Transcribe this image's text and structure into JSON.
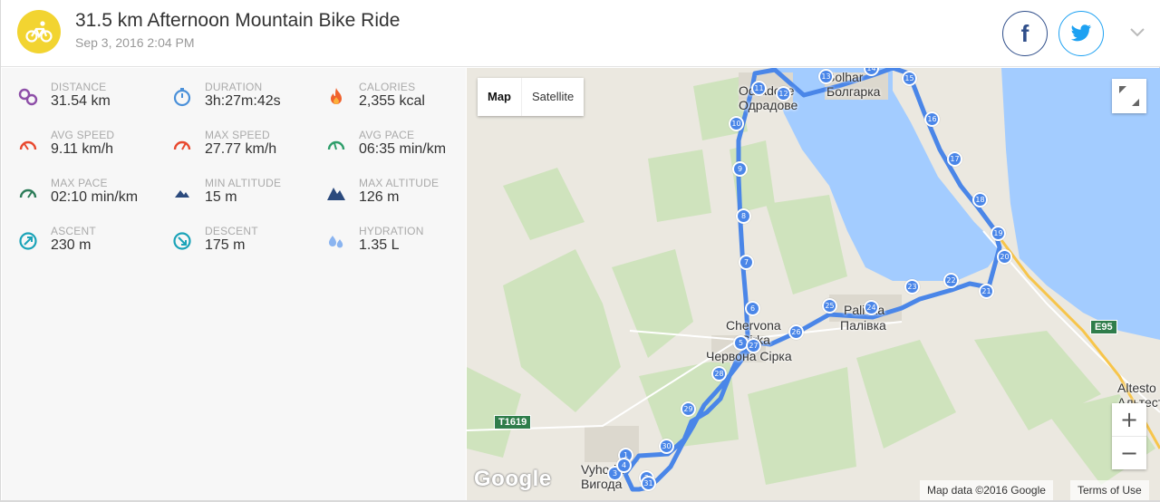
{
  "activity": {
    "title": "31.5 km Afternoon Mountain Bike Ride",
    "datetime": "Sep 3, 2016 2:04 PM",
    "sport_icon": "mountain-bike-icon",
    "badge_color": "#f2d431"
  },
  "share": {
    "facebook_label": "f",
    "facebook_icon": "facebook-icon",
    "twitter_icon": "twitter-icon",
    "menu_icon": "chevron-down-icon"
  },
  "stats": [
    {
      "key": "distance",
      "label": "DISTANCE",
      "value": "31.54 km",
      "icon": "distance-icon",
      "color": "#8e4fa8"
    },
    {
      "key": "duration",
      "label": "DURATION",
      "value": "3h:27m:42s",
      "icon": "stopwatch-icon",
      "color": "#4a90d9"
    },
    {
      "key": "calories",
      "label": "CALORIES",
      "value": "2,355 kcal",
      "icon": "flame-icon",
      "color": "#f0622d"
    },
    {
      "key": "avg_speed",
      "label": "AVG SPEED",
      "value": "9.11 km/h",
      "icon": "speedometer-icon",
      "color": "#e8492f"
    },
    {
      "key": "max_speed",
      "label": "MAX SPEED",
      "value": "27.77 km/h",
      "icon": "speedometer-icon",
      "color": "#e8492f"
    },
    {
      "key": "avg_pace",
      "label": "AVG PACE",
      "value": "06:35 min/km",
      "icon": "pace-gauge-icon",
      "color": "#2e9e6a"
    },
    {
      "key": "max_pace",
      "label": "MAX PACE",
      "value": "02:10 min/km",
      "icon": "pace-gauge-icon",
      "color": "#2e7d5a"
    },
    {
      "key": "min_altitude",
      "label": "MIN ALTITUDE",
      "value": "15 m",
      "icon": "mountain-small-icon",
      "color": "#2b4a7d"
    },
    {
      "key": "max_altitude",
      "label": "MAX ALTITUDE",
      "value": "126 m",
      "icon": "mountain-large-icon",
      "color": "#2b4a7d"
    },
    {
      "key": "ascent",
      "label": "ASCENT",
      "value": "230 m",
      "icon": "ascent-arrow-icon",
      "color": "#1aa3b8"
    },
    {
      "key": "descent",
      "label": "DESCENT",
      "value": "175 m",
      "icon": "descent-arrow-icon",
      "color": "#1aa3b8"
    },
    {
      "key": "hydration",
      "label": "HYDRATION",
      "value": "1.35 L",
      "icon": "water-drops-icon",
      "color": "#8ab4f0"
    }
  ],
  "map": {
    "type_buttons": {
      "map": "Map",
      "satellite": "Satellite"
    },
    "zoom_in": "+",
    "zoom_out": "−",
    "logo": "Google",
    "attribution": "Map data ©2016 Google",
    "terms": "Terms of Use",
    "labels": {
      "odradove": "Odradove",
      "odradove_cyr": "Одрадове",
      "bolhar": "Bolhar",
      "bolhar_cyr": "Болгарка",
      "chervona": "Chervona",
      "sirka": "Sirka",
      "cherv_cyr": "Червона Сірка",
      "palivka": "Palivka",
      "palivka_cyr": "Палівка",
      "vyhoda": "Vyhoda",
      "vyhoda_cyr": "Вигода",
      "altesto": "Altesto",
      "altesto_cyr": "Альтест",
      "road_t1619": "T1619",
      "road_e95": "E95"
    },
    "route_color": "#4a86e8",
    "markers": [
      "1",
      "2",
      "3",
      "4",
      "5",
      "6",
      "7",
      "8",
      "9",
      "10",
      "11",
      "12",
      "13",
      "14",
      "15",
      "16",
      "17",
      "18",
      "19",
      "20",
      "21",
      "22",
      "23",
      "24",
      "25",
      "26",
      "27",
      "28",
      "29",
      "30",
      "31"
    ]
  }
}
